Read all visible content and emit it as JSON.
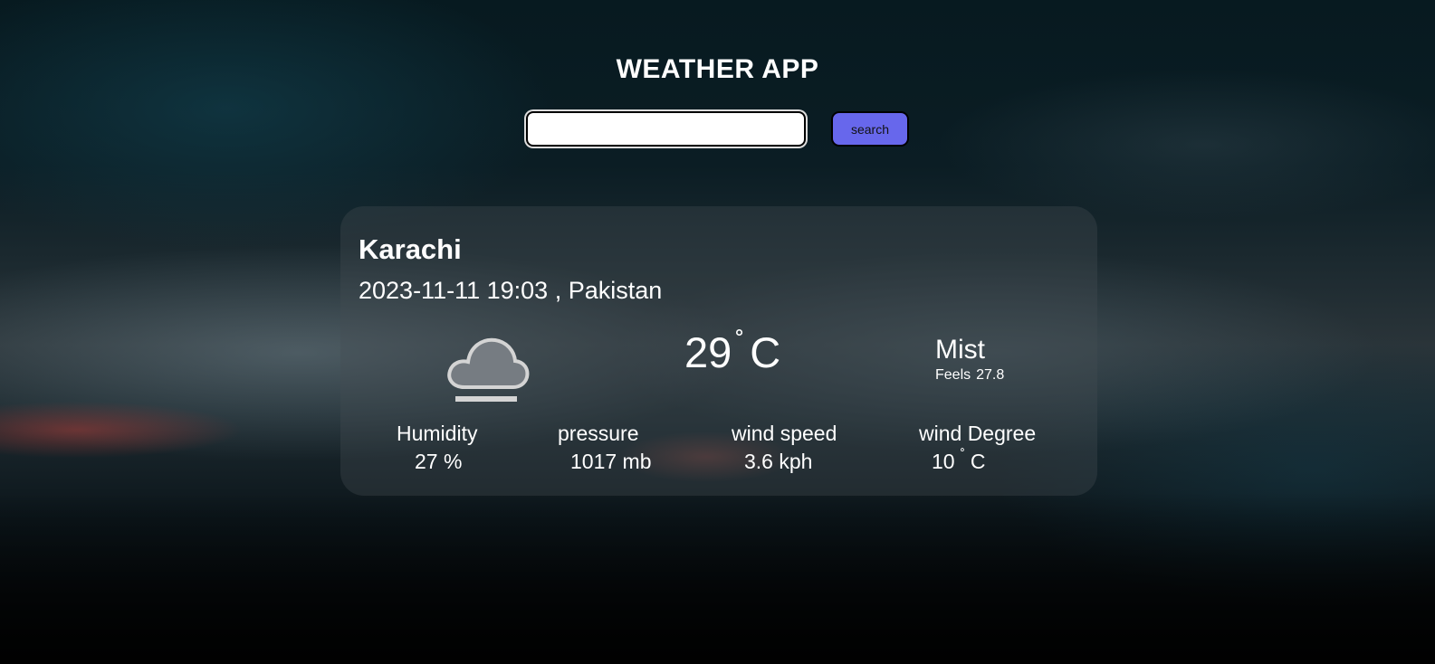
{
  "app": {
    "title": "WEATHER APP"
  },
  "search": {
    "value": "",
    "placeholder": "",
    "button_label": "search"
  },
  "weather": {
    "city": "Karachi",
    "datetime": "2023-11-11 19:03",
    "separator": ",",
    "country": "Pakistan",
    "icon": "mist-cloud-icon",
    "temperature": "29",
    "degree_symbol": "˚",
    "unit": "C",
    "condition": "Mist",
    "feels_label": "Feels",
    "feels_value": "27.8"
  },
  "stats": {
    "humidity": {
      "label": "Humidity",
      "value": "27 %"
    },
    "pressure": {
      "label": "pressure",
      "value": "1017 mb"
    },
    "wind_speed": {
      "label": "wind speed",
      "value": "3.6 kph"
    },
    "wind_degree": {
      "label": "wind Degree",
      "value": "10",
      "degree_symbol": "˚",
      "unit": "C"
    }
  },
  "colors": {
    "button": "#6767ec",
    "text": "#ffffff"
  }
}
